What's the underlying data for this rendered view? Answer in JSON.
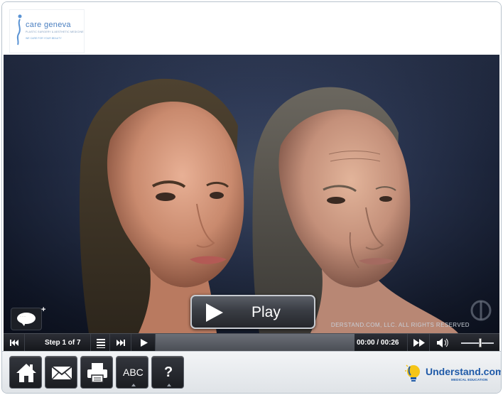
{
  "header": {
    "logo_title": "care geneva",
    "logo_subtitle": "PLASTIC SURGERY & AESTHETIC MEDICINE",
    "logo_tagline": "WE CARE FOR YOUR BEAUTY"
  },
  "player": {
    "play_label": "Play",
    "watermark": "DERSTAND.COM, LLC. ALL RIGHTS RESERVED",
    "caption_toggle_symbol": "+",
    "step_text": "Step 1 of 7",
    "time_text": "00:00 / 00:26",
    "progress_fraction": 0,
    "volume_fraction": 0.55
  },
  "footer": {
    "glossary_label": "ABC",
    "help_label": "?",
    "brand_name": "Understand.com",
    "brand_tm": "™",
    "brand_sub": "MEDICAL EDUCATION"
  },
  "icons": {
    "home": "home-icon",
    "email": "email-icon",
    "print": "printer-icon",
    "prev": "skip-back-icon",
    "next": "skip-forward-icon",
    "chapters": "list-icon",
    "play": "play-icon",
    "forward": "fast-forward-icon",
    "volume": "speaker-icon"
  },
  "colors": {
    "brand_blue": "#1f5aa8",
    "logo_blue": "#4a7fc0",
    "control_bar": "#15171b",
    "seek_track": "#5a5d64"
  }
}
